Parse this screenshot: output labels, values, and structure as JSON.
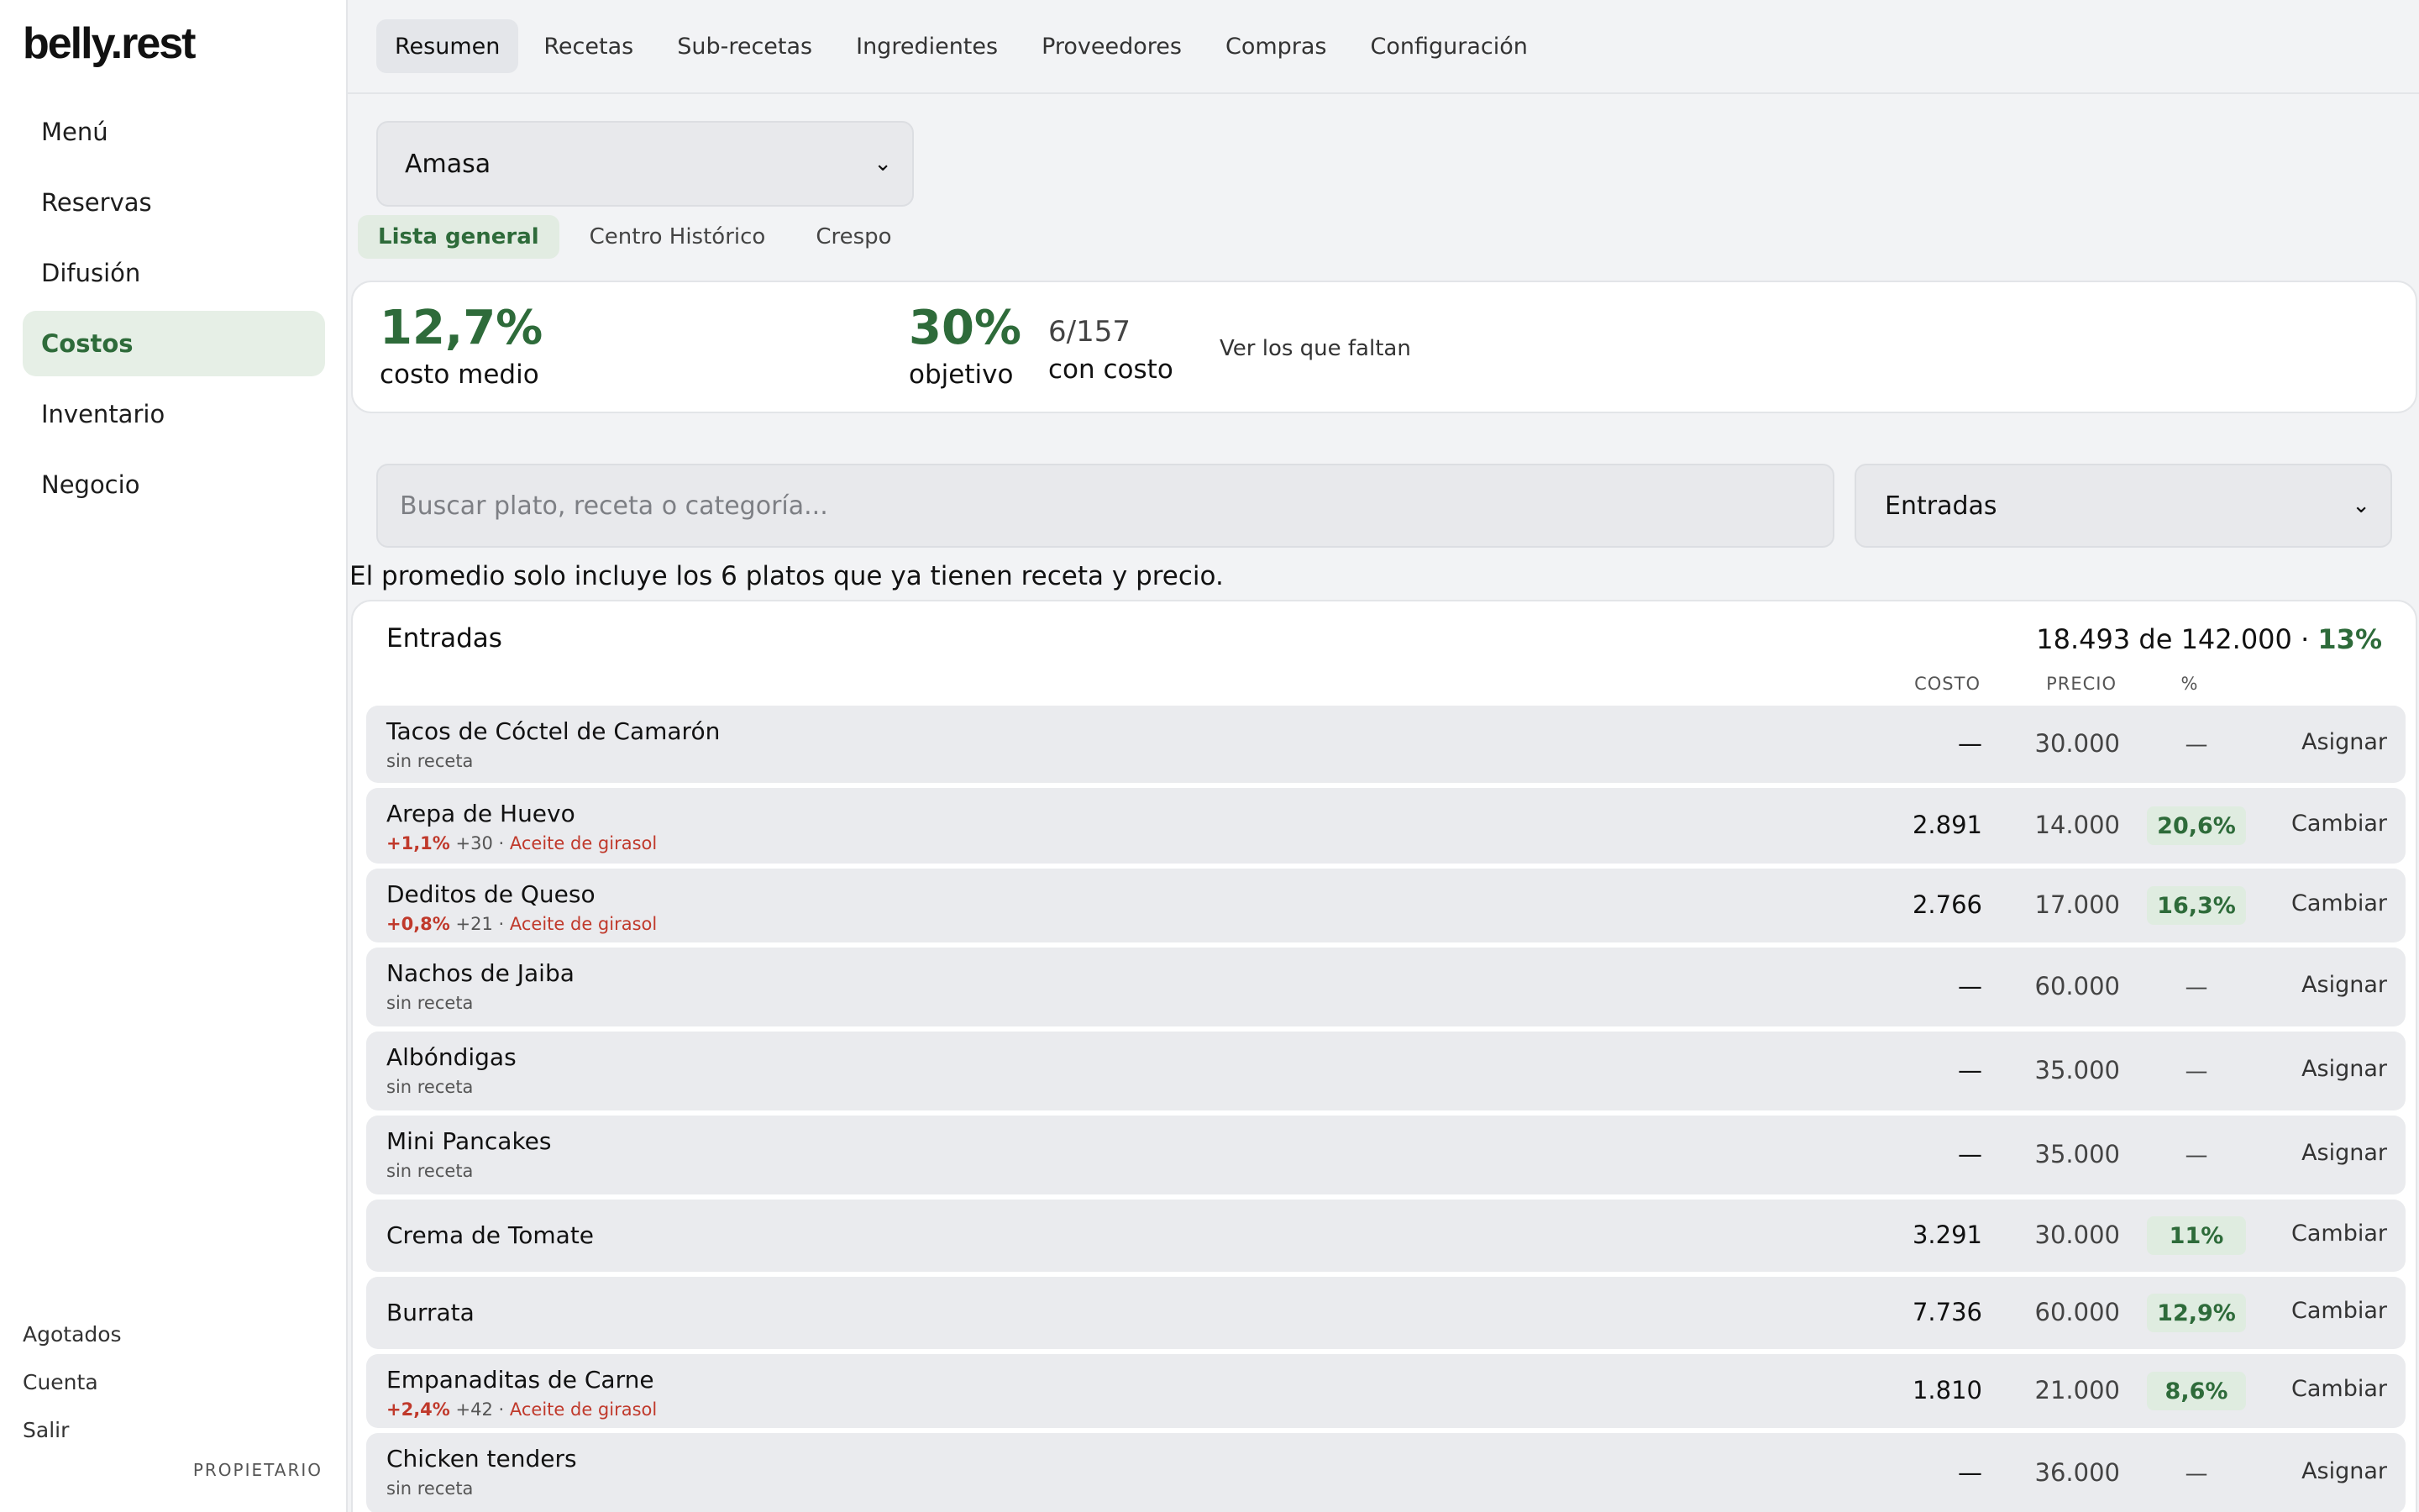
{
  "app": {
    "logo": "belly.rest"
  },
  "sidebar": {
    "items": [
      {
        "label": "Menú",
        "active": false
      },
      {
        "label": "Reservas",
        "active": false
      },
      {
        "label": "Difusión",
        "active": false
      },
      {
        "label": "Costos",
        "active": true
      },
      {
        "label": "Inventario",
        "active": false
      },
      {
        "label": "Negocio",
        "active": false
      }
    ],
    "footer": [
      "Agotados",
      "Cuenta",
      "Salir"
    ],
    "role": "PROPIETARIO"
  },
  "top_tabs": [
    {
      "label": "Resumen",
      "active": true
    },
    {
      "label": "Recetas",
      "active": false
    },
    {
      "label": "Sub-recetas",
      "active": false
    },
    {
      "label": "Ingredientes",
      "active": false
    },
    {
      "label": "Proveedores",
      "active": false
    },
    {
      "label": "Compras",
      "active": false
    },
    {
      "label": "Configuración",
      "active": false
    }
  ],
  "restaurant_select": {
    "value": "Amasa"
  },
  "sub_tabs": [
    {
      "label": "Lista general",
      "active": true
    },
    {
      "label": "Centro Histórico",
      "active": false
    },
    {
      "label": "Crespo",
      "active": false
    }
  ],
  "summary": {
    "avg_cost": "12,7%",
    "avg_cost_label": "costo medio",
    "target": "30%",
    "target_label": "objetivo",
    "with_cost": "6/157",
    "with_cost_label": "con costo",
    "missing_link": "Ver los que faltan"
  },
  "search": {
    "placeholder": "Buscar plato, receta o categoría...",
    "value": ""
  },
  "category_select": {
    "value": "Entradas"
  },
  "note": "El promedio solo incluye los 6 platos que ya tienen receta y precio.",
  "panel": {
    "title": "Entradas",
    "total_text": "18.493 de 142.000 · ",
    "total_pct": "13%",
    "columns": {
      "cost": "COSTO",
      "price": "PRECIO",
      "pct": "%"
    }
  },
  "dishes": [
    {
      "name": "Tacos de Cóctel de Camarón",
      "sub_type": "plain",
      "sub": "sin receta",
      "cost": "—",
      "price": "30.000",
      "pct": "—",
      "pct_ok": false,
      "action": "Asignar",
      "height": 92
    },
    {
      "name": "Arepa de Huevo",
      "sub_type": "alert",
      "sub_up": "+1,1%",
      "sub_delta": " +30 · ",
      "sub_alert": "Aceite de girasol",
      "cost": "2.891",
      "price": "14.000",
      "pct": "20,6%",
      "pct_ok": true,
      "action": "Cambiar",
      "height": 90
    },
    {
      "name": "Deditos de Queso",
      "sub_type": "alert",
      "sub_up": "+0,8%",
      "sub_delta": " +21 · ",
      "sub_alert": "Aceite de girasol",
      "cost": "2.766",
      "price": "17.000",
      "pct": "16,3%",
      "pct_ok": true,
      "action": "Cambiar",
      "height": 88
    },
    {
      "name": "Nachos de Jaiba",
      "sub_type": "plain",
      "sub": "sin receta",
      "cost": "—",
      "price": "60.000",
      "pct": "—",
      "pct_ok": false,
      "action": "Asignar",
      "height": 94
    },
    {
      "name": "Albóndigas",
      "sub_type": "plain",
      "sub": "sin receta",
      "cost": "—",
      "price": "35.000",
      "pct": "—",
      "pct_ok": false,
      "action": "Asignar",
      "height": 94
    },
    {
      "name": "Mini Pancakes",
      "sub_type": "plain",
      "sub": "sin receta",
      "cost": "—",
      "price": "35.000",
      "pct": "—",
      "pct_ok": false,
      "action": "Asignar",
      "height": 94
    },
    {
      "name": "Crema de Tomate",
      "sub_type": "none",
      "cost": "3.291",
      "price": "30.000",
      "pct": "11%",
      "pct_ok": true,
      "action": "Cambiar",
      "height": 86
    },
    {
      "name": "Burrata",
      "sub_type": "none",
      "cost": "7.736",
      "price": "60.000",
      "pct": "12,9%",
      "pct_ok": true,
      "action": "Cambiar",
      "height": 86
    },
    {
      "name": "Empanaditas de Carne",
      "sub_type": "alert",
      "sub_up": "+2,4%",
      "sub_delta": " +42 · ",
      "sub_alert": "Aceite de girasol",
      "cost": "1.810",
      "price": "21.000",
      "pct": "8,6%",
      "pct_ok": true,
      "action": "Cambiar",
      "height": 88
    },
    {
      "name": "Chicken tenders",
      "sub_type": "plain",
      "sub": "sin receta",
      "cost": "—",
      "price": "36.000",
      "pct": "—",
      "pct_ok": false,
      "action": "Asignar",
      "height": 96
    }
  ]
}
